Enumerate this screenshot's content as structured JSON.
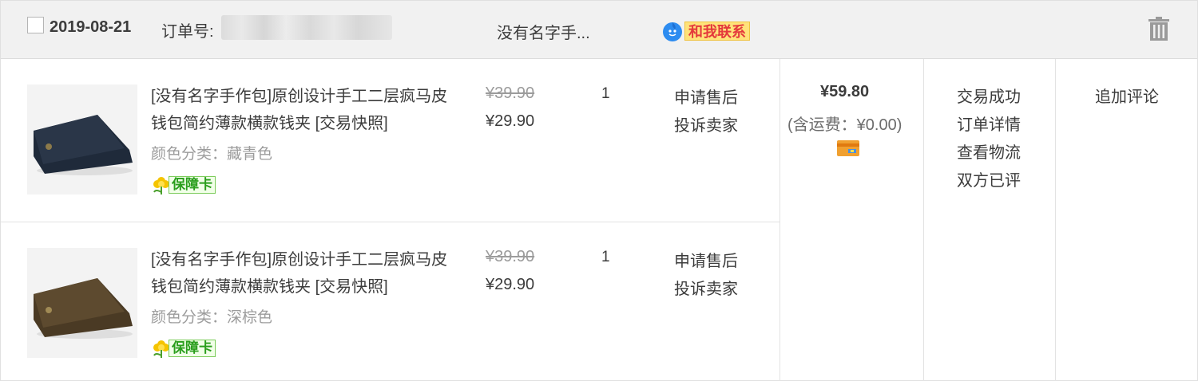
{
  "header": {
    "date": "2019-08-21",
    "order_no_label": "订单号:",
    "shop_name": "没有名字手...",
    "contact_label": "和我联系",
    "icons": {
      "checkbox": "checkbox-icon",
      "contact": "wangwang-chat-icon",
      "trash": "trash-icon"
    }
  },
  "items": [
    {
      "title": "[没有名字手作包]原创设计手工二层疯马皮钱包简约薄款横款钱夹",
      "snapshot_label": "[交易快照]",
      "sku": "颜色分类：藏青色",
      "badge": "保障卡",
      "price_original": "¥39.90",
      "price_current": "¥29.90",
      "quantity": "1",
      "actions": [
        "申请售后",
        "投诉卖家"
      ],
      "wallet_color": "#2a3648"
    },
    {
      "title": "[没有名字手作包]原创设计手工二层疯马皮钱包简约薄款横款钱夹",
      "snapshot_label": "[交易快照]",
      "sku": "颜色分类：深棕色",
      "badge": "保障卡",
      "price_original": "¥39.90",
      "price_current": "¥29.90",
      "quantity": "1",
      "actions": [
        "申请售后",
        "投诉卖家"
      ],
      "wallet_color": "#5d4a2f"
    }
  ],
  "payment": {
    "total": "¥59.80",
    "shipping_note": "(含运费：¥0.00)",
    "icon": "credit-card-icon"
  },
  "status": {
    "result": "交易成功",
    "links": [
      "订单详情",
      "查看物流",
      "双方已评"
    ]
  },
  "review": {
    "label": "追加评论"
  },
  "colors": {
    "header_bg": "#f1f1f1",
    "border": "#e3e3e3",
    "text": "#3c3c3c",
    "muted": "#9c9c9c",
    "contact_bg": "#ffe27a",
    "contact_text": "#e4393c",
    "badge_green": "#2a9e1c"
  }
}
